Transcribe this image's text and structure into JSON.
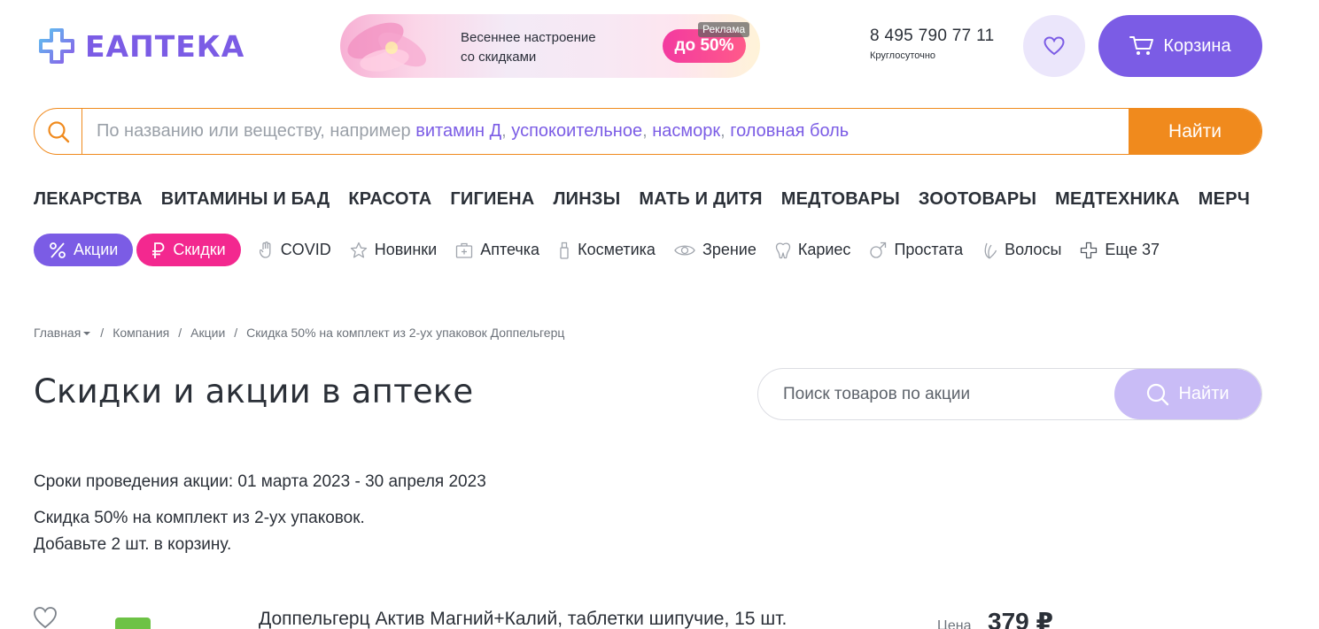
{
  "header": {
    "logo_text": "ЕАПТЕКА",
    "promo": {
      "line1": "Весеннее настроение",
      "line2": "со скидками",
      "discount": "до 50%",
      "ad_label": "Реклама"
    },
    "phone": "8 495 790 77 11",
    "phone_note": "Круглосуточно",
    "cart_label": "Корзина",
    "colors": {
      "brand": "#7b5ce5",
      "accent": "#f08a1d",
      "pink": "#f3288f"
    }
  },
  "search": {
    "placeholder_prefix": "По названию или веществу, например",
    "hints": [
      "витамин Д",
      "успокоительное",
      "насморк",
      "головная боль"
    ],
    "button_label": "Найти"
  },
  "categories": [
    "ЛЕКАРСТВА",
    "ВИТАМИНЫ И БАД",
    "КРАСОТА",
    "ГИГИЕНА",
    "ЛИНЗЫ",
    "МАТЬ И ДИТЯ",
    "МЕДТОВАРЫ",
    "ЗООТОВАРЫ",
    "МЕДТЕХНИКА",
    "МЕРЧ"
  ],
  "chips": {
    "actions": {
      "label": "Акции",
      "icon": "percent-icon"
    },
    "discounts": {
      "label": "Скидки",
      "icon": "ruble-icon"
    },
    "items": [
      {
        "label": "COVID",
        "icon": "hand-icon"
      },
      {
        "label": "Новинки",
        "icon": "star-icon"
      },
      {
        "label": "Аптечка",
        "icon": "first-aid-kit-icon"
      },
      {
        "label": "Косметика",
        "icon": "cosmetics-bottle-icon"
      },
      {
        "label": "Зрение",
        "icon": "eye-icon"
      },
      {
        "label": "Кариес",
        "icon": "tooth-icon"
      },
      {
        "label": "Простата",
        "icon": "male-icon"
      },
      {
        "label": "Волосы",
        "icon": "hair-icon"
      },
      {
        "label": "Еще 37",
        "icon": "plus-cross-icon"
      }
    ]
  },
  "breadcrumbs": [
    "Главная",
    "Компания",
    "Акции",
    "Скидка 50% на комплект из 2-ух упаковок Доппельгерц"
  ],
  "page": {
    "title": "Скидки и акции в аптеке",
    "promo_search_placeholder": "Поиск товаров по акции",
    "promo_search_button": "Найти",
    "terms": "Сроки проведения акции: 01 марта 2023 - 30 апреля 2023",
    "description_line1": "Скидка 50% на комплект из 2-ух упаковок.",
    "description_line2": "Добавьте 2 шт. в корзину."
  },
  "product": {
    "name": "Доппельгерц Актив Магний+Калий, таблетки шипучие, 15 шт.",
    "price_label": "Цена",
    "price": "379 ₽"
  }
}
